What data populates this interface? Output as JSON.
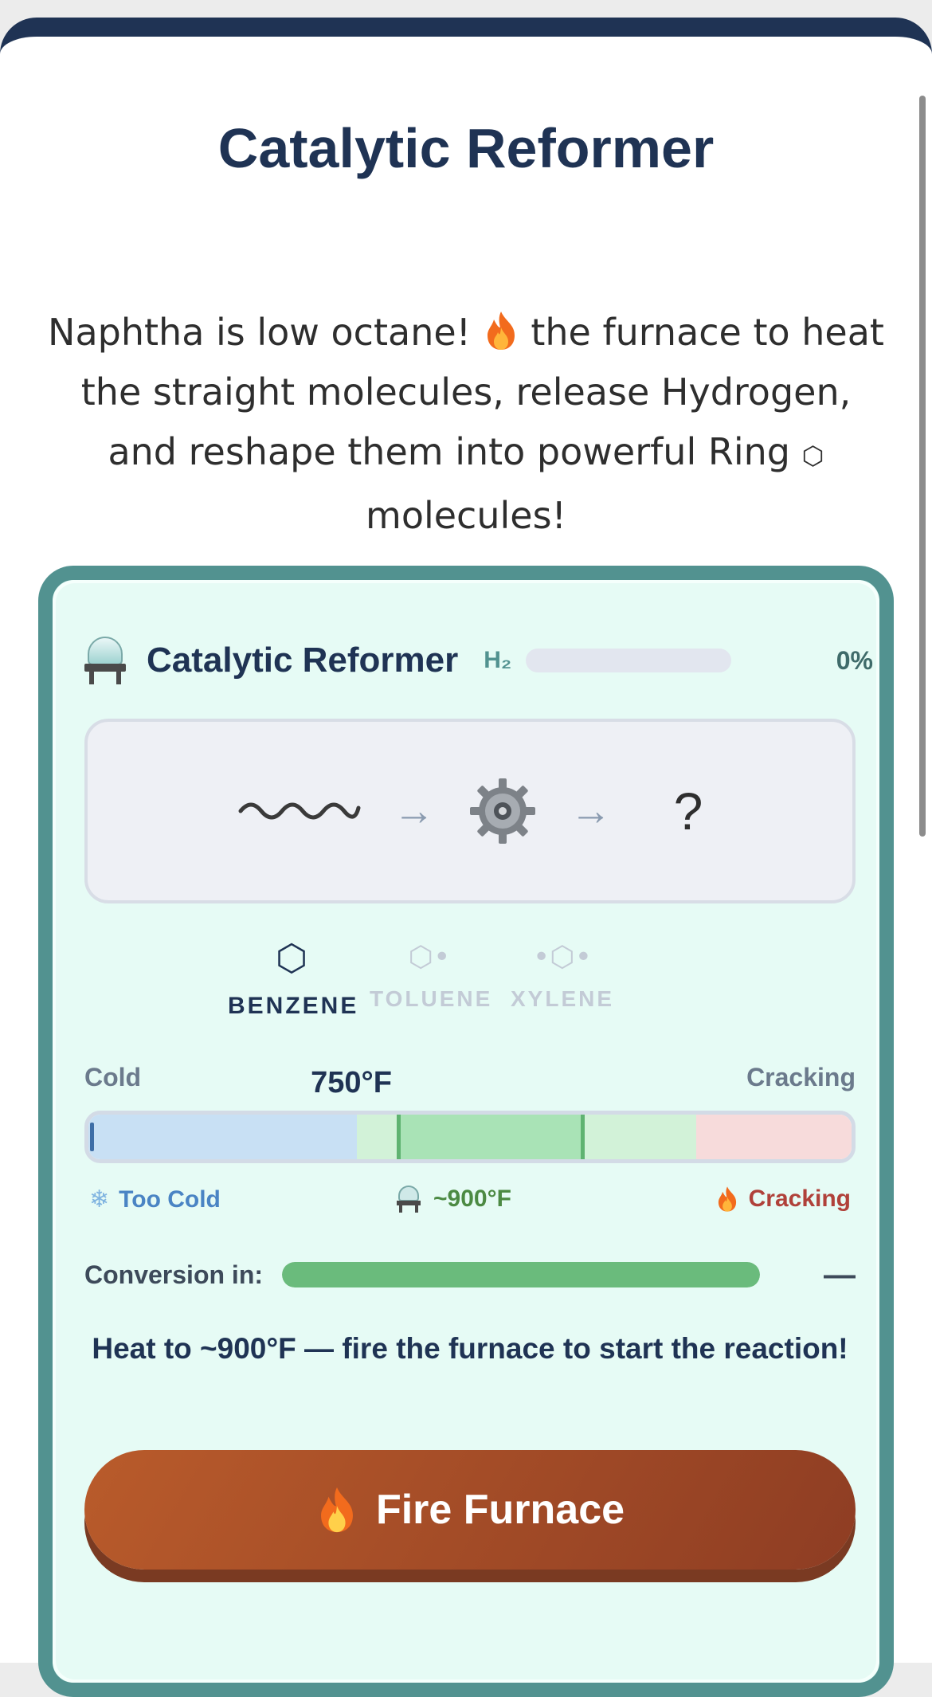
{
  "page": {
    "title": "Catalytic Reformer",
    "intro_before": "Naphtha is low octane!",
    "intro_after": "the furnace to heat the straight molecules, release Hydrogen, and reshape them into powerful Ring",
    "intro_end": "molecules!",
    "fire_icon": "fire-icon",
    "ring_glyph": "⬡"
  },
  "card": {
    "title": "Catalytic Reformer",
    "h2_label": "H₂",
    "h2_progress_pct": 0,
    "h2_pct_text": "0%",
    "reaction": {
      "input_glyph": "wavy-chain-icon",
      "catalyst": "gear-icon",
      "output": "?"
    },
    "rings": [
      {
        "glyph": "⬡",
        "name": "BENZENE",
        "selected": true
      },
      {
        "glyph": "⬡•",
        "name": "TOLUENE",
        "selected": false
      },
      {
        "glyph": "•⬡•",
        "name": "XYLENE",
        "selected": false
      }
    ],
    "temp": {
      "cold_label": "Cold",
      "current": "750°F",
      "crack_label": "Cracking",
      "too_cold": "Too Cold",
      "ideal": "~900°F",
      "cracking": "Cracking"
    },
    "conversion": {
      "label": "Conversion in:",
      "value": "—",
      "fill_pct": 100
    },
    "hint": "Heat to ~900°F — fire the furnace to start the reaction!",
    "fire_button": "Fire Furnace"
  },
  "colors": {
    "navy": "#1f3354",
    "teal": "#529290",
    "card_bg": "#e6fbf5",
    "button": "#a54d27",
    "ideal_green": "#5fb371"
  }
}
